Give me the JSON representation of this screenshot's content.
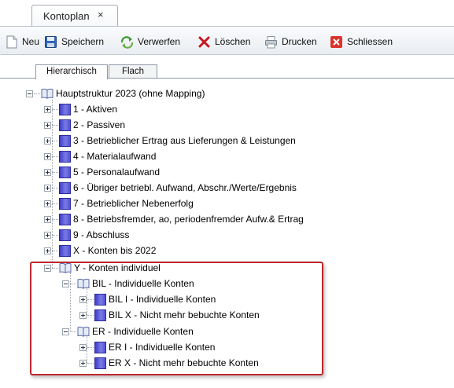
{
  "doc_tab": {
    "title": "Kontoplan",
    "close_glyph": "×"
  },
  "toolbar": {
    "buttons": [
      {
        "label": "Neu",
        "icon": "new-document-icon"
      },
      {
        "label": "Speichern",
        "icon": "floppy-disk-icon"
      },
      {
        "label": "Verwerfen",
        "icon": "discard-arrows-icon"
      },
      {
        "label": "Löschen",
        "icon": "red-x-icon"
      },
      {
        "label": "Drucken",
        "icon": "printer-icon"
      },
      {
        "label": "Schliessen",
        "icon": "close-box-icon"
      }
    ]
  },
  "view_tabs": [
    {
      "label": "Hierarchisch",
      "active": true
    },
    {
      "label": "Flach",
      "active": false
    }
  ],
  "tree": {
    "root": "Hauptstruktur 2023 (ohne Mapping)",
    "items": [
      "1 - Aktiven",
      "2 - Passiven",
      "3 - Betrieblicher Ertrag aus Lieferungen & Leistungen",
      "4 - Materialaufwand",
      "5 - Personalaufwand",
      "6 - Übriger betriebl. Aufwand, Abschr./Werte/Ergebnis",
      "7 - Betrieblicher Nebenerfolg",
      "8 - Betriebsfremder, ao, periodenfremder Aufw.& Ertrag",
      "9 - Abschluss",
      "X - Konten bis 2022"
    ],
    "individual": {
      "label": "Y - Konten individuel",
      "groups": [
        {
          "label": "BIL - Individuelle Konten",
          "children": [
            "BIL I - Individuelle Konten",
            "BIL X - Nicht mehr bebuchte Konten"
          ]
        },
        {
          "label": "ER - Individuelle Konten",
          "children": [
            "ER I - Individuelle Konten",
            "ER X - Nicht mehr bebuchte Konten"
          ]
        }
      ]
    }
  },
  "colors": {
    "highlight": "#c0272d",
    "account_block": "#4a4ad0"
  }
}
